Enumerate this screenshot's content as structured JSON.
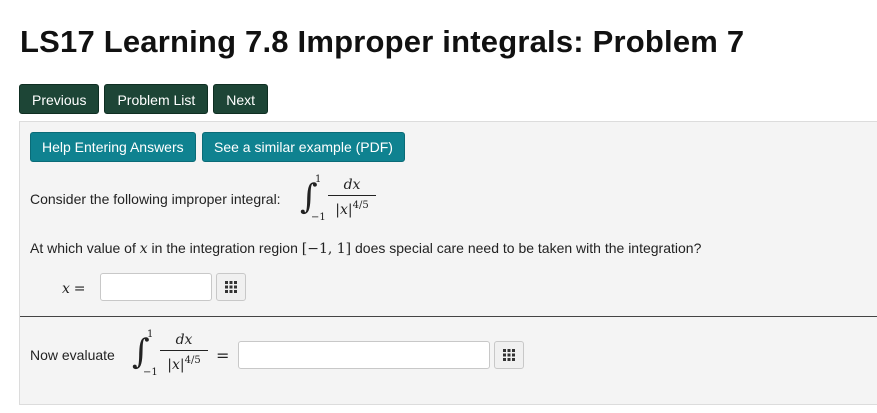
{
  "page": {
    "title": "LS17 Learning 7.8 Improper integrals: Problem 7"
  },
  "nav": {
    "previous": "Previous",
    "problem_list": "Problem List",
    "next": "Next"
  },
  "problem": {
    "help_button": "Help Entering Answers",
    "example_button": "See a similar example (PDF)",
    "consider_text": "Consider the following improper integral:",
    "integral": {
      "lower": "−1",
      "upper": "1",
      "numerator": "dx",
      "denominator_base": "|x|",
      "denominator_exp": "4/5"
    },
    "question": {
      "before": "At which value of ",
      "var": "x",
      "middle": " in the integration region ",
      "region": "[−1, 1]",
      "after": " does special care need to be taken with the integration?"
    },
    "answer1": {
      "label_var": "x",
      "label_eq": "=",
      "value": "",
      "placeholder": ""
    },
    "evaluate_text": "Now evaluate",
    "answer2": {
      "eq": "=",
      "value": "",
      "placeholder": ""
    },
    "matrix_icon": "grid-matrix-icon"
  }
}
